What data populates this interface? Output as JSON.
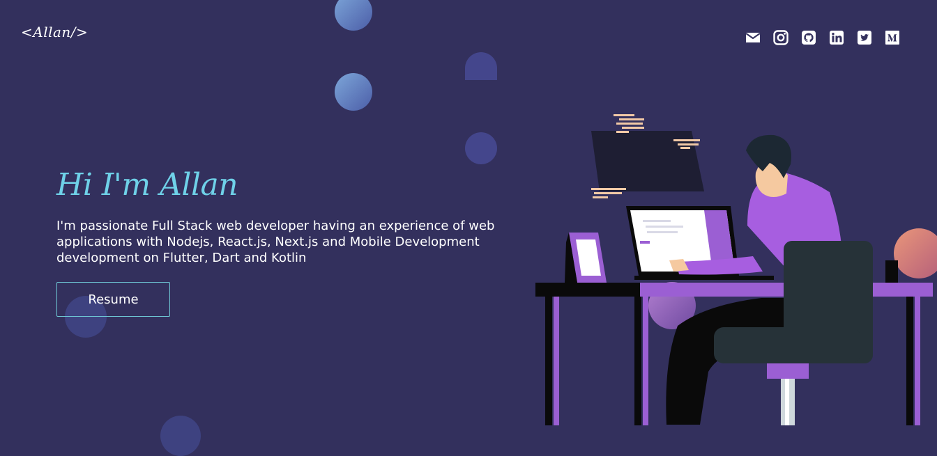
{
  "header": {
    "logo": "<Allan/>",
    "social": [
      {
        "name": "mail-icon"
      },
      {
        "name": "instagram-icon"
      },
      {
        "name": "github-icon"
      },
      {
        "name": "linkedin-icon"
      },
      {
        "name": "twitter-icon"
      },
      {
        "name": "medium-icon"
      }
    ]
  },
  "hero": {
    "title": "Hi I'm Allan",
    "description": "I'm passionate Full Stack web developer having an experience of web applications with Nodejs, React.js, Next.js and Mobile Development development on Flutter, Dart and Kotlin",
    "button_label": "Resume"
  },
  "colors": {
    "background": "#33305d",
    "title": "#6fd1e8",
    "button_border": "#6fc9d6",
    "accent_purple": "#9b5fd3"
  }
}
